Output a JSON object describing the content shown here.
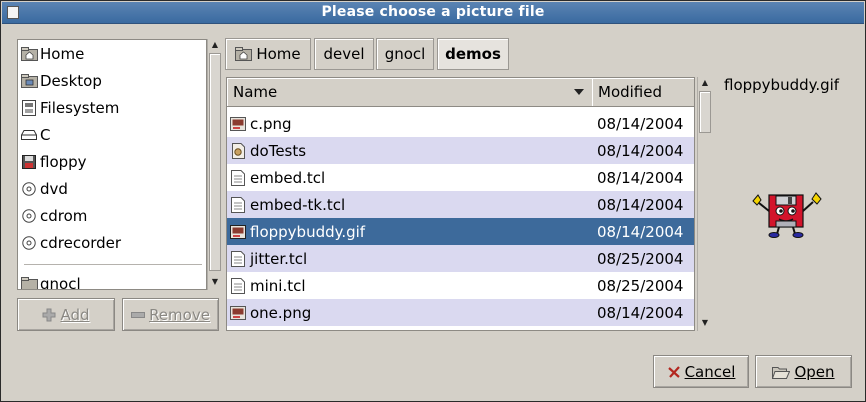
{
  "window": {
    "title": "Please choose a picture file"
  },
  "places": [
    {
      "label": "Home",
      "icon": "home-folder-icon"
    },
    {
      "label": "Desktop",
      "icon": "desktop-folder-icon"
    },
    {
      "label": "Filesystem",
      "icon": "filesystem-icon"
    },
    {
      "label": "C",
      "icon": "drive-icon"
    },
    {
      "label": "floppy",
      "icon": "floppy-icon"
    },
    {
      "label": "dvd",
      "icon": "disc-icon"
    },
    {
      "label": "cdrom",
      "icon": "disc-icon"
    },
    {
      "label": "cdrecorder",
      "icon": "disc-icon"
    }
  ],
  "bookmarks": [
    {
      "label": "gnocl",
      "icon": "folder-icon"
    }
  ],
  "buttons": {
    "add": "Add",
    "remove": "Remove",
    "cancel": "Cancel",
    "open": "Open"
  },
  "path": [
    {
      "label": "Home",
      "icon": "home-folder-icon",
      "active": false
    },
    {
      "label": "devel",
      "active": false
    },
    {
      "label": "gnocl",
      "active": false
    },
    {
      "label": "demos",
      "active": true
    }
  ],
  "columns": {
    "name": "Name",
    "modified": "Modified"
  },
  "files": [
    {
      "name": "c.png",
      "date": "08/14/2004",
      "icon": "image-file-icon"
    },
    {
      "name": "doTests",
      "date": "08/14/2004",
      "icon": "script-file-icon"
    },
    {
      "name": "embed.tcl",
      "date": "08/14/2004",
      "icon": "text-file-icon"
    },
    {
      "name": "embed-tk.tcl",
      "date": "08/14/2004",
      "icon": "text-file-icon"
    },
    {
      "name": "floppybuddy.gif",
      "date": "08/14/2004",
      "icon": "image-file-icon",
      "selected": true
    },
    {
      "name": "jitter.tcl",
      "date": "08/25/2004",
      "icon": "text-file-icon"
    },
    {
      "name": "mini.tcl",
      "date": "08/25/2004",
      "icon": "text-file-icon"
    },
    {
      "name": "one.png",
      "date": "08/14/2004",
      "icon": "image-file-icon"
    }
  ],
  "preview": {
    "filename": "floppybuddy.gif",
    "image": "floppy-buddy-mascot"
  },
  "colors": {
    "titlebar": "#3a6aa0",
    "selection": "#3d6a9b",
    "alt_row": "#dad9f0",
    "window_bg": "#d4d0c8"
  }
}
